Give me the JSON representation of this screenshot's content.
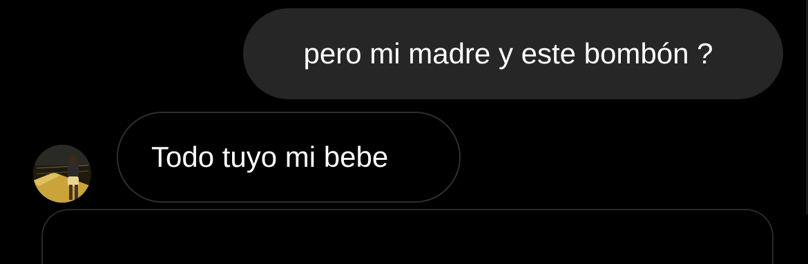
{
  "conversation": {
    "messages": [
      {
        "direction": "sent",
        "text": "pero mi madre y este bombón ?"
      },
      {
        "direction": "received",
        "text": "Todo tuyo mi bebe"
      }
    ]
  },
  "colors": {
    "background": "#000000",
    "sent_bubble": "#262626",
    "received_bubble_border": "#2f2f2f",
    "text": "#ffffff"
  },
  "icons": {
    "contact_avatar": "contact-avatar-photo"
  }
}
